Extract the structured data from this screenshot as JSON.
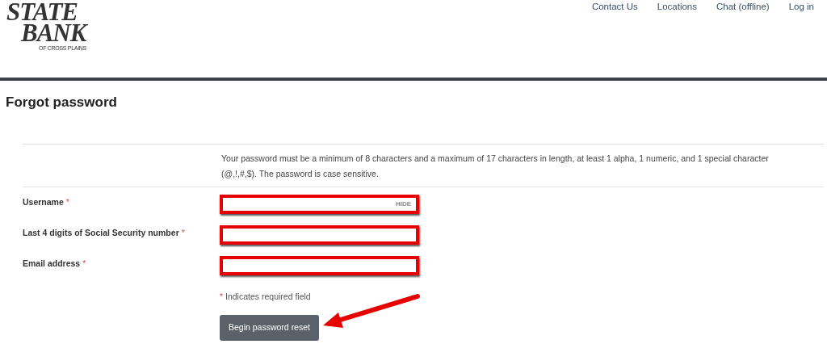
{
  "logo": {
    "line_1": "STATE",
    "line_2": "BANK",
    "tagline": "OF CROSS PLAINS"
  },
  "nav": [
    "Contact Us",
    "Locations",
    "Chat (offline)",
    "Log in"
  ],
  "title": "Forgot password",
  "note": "Your password must be a minimum of 8 characters and a maximum of 17 characters in length, at least 1 alpha, 1 numeric, and 1 special character (@,!,#,$). The password is case sensitive.",
  "fields": [
    {
      "label": "Username",
      "required_mark": "*",
      "toggle": "HIDE"
    },
    {
      "label": "Last 4 digits of Social Security number",
      "required_mark": "*"
    },
    {
      "label": "Email address",
      "required_mark": "*"
    }
  ],
  "required_note": {
    "mark": "*",
    "text": "Indicates required field"
  },
  "submit": "Begin password reset",
  "annotations": {
    "highlight_fields": true,
    "arrow_to_submit": true
  }
}
